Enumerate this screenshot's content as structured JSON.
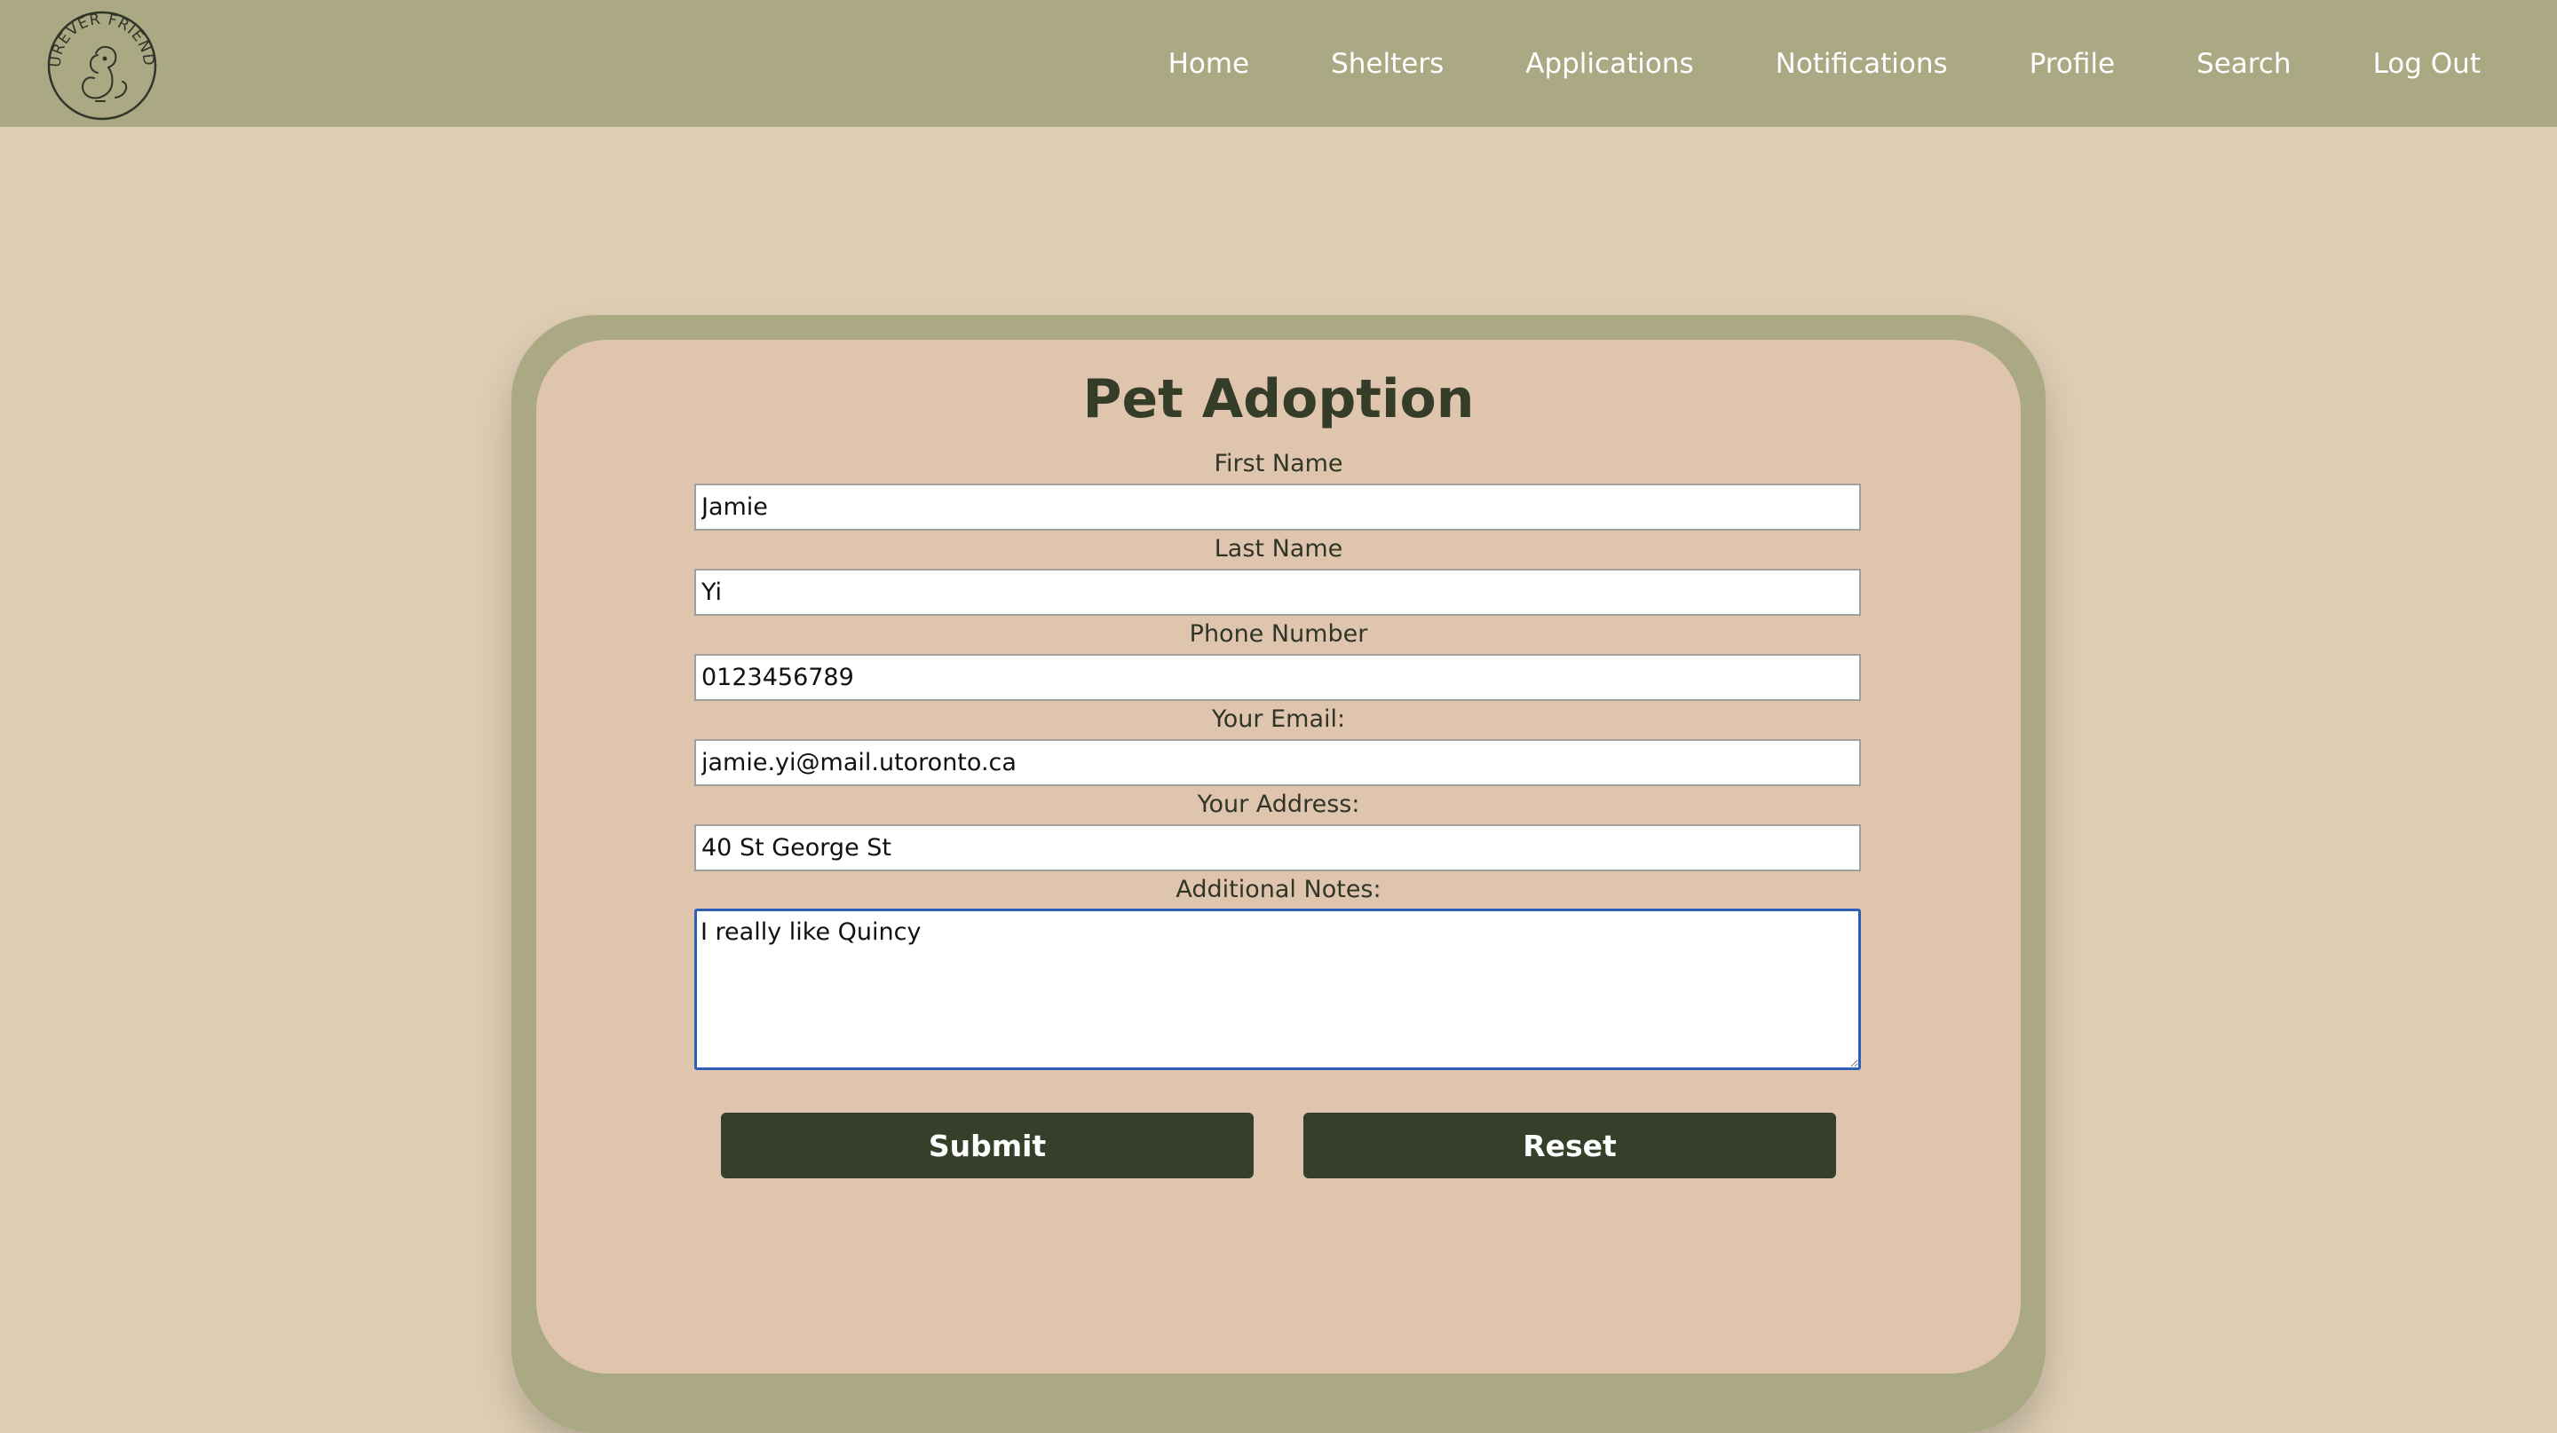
{
  "brand": {
    "logo_text": "FUREVER FRIENDS"
  },
  "nav": {
    "items": [
      {
        "label": "Home"
      },
      {
        "label": "Shelters"
      },
      {
        "label": "Applications"
      },
      {
        "label": "Notifications"
      },
      {
        "label": "Profile"
      },
      {
        "label": "Search"
      },
      {
        "label": "Log Out"
      }
    ]
  },
  "form": {
    "title": "Pet Adoption",
    "fields": [
      {
        "label": "First Name",
        "value": "Jamie"
      },
      {
        "label": "Last Name",
        "value": "Yi"
      },
      {
        "label": "Phone Number",
        "value": "0123456789"
      },
      {
        "label": "Your Email:",
        "value": "jamie.yi@mail.utoronto.ca"
      },
      {
        "label": "Your Address:",
        "value": "40 St George St"
      }
    ],
    "notes": {
      "label": "Additional Notes:",
      "value": "I really like Quincy"
    },
    "submit_label": "Submit",
    "reset_label": "Reset"
  },
  "colors": {
    "navbar": "#aaa984",
    "page_background": "#ddcdb3",
    "card_background": "#e0c5ae",
    "button": "#353f2a",
    "title_text": "#353d28"
  }
}
